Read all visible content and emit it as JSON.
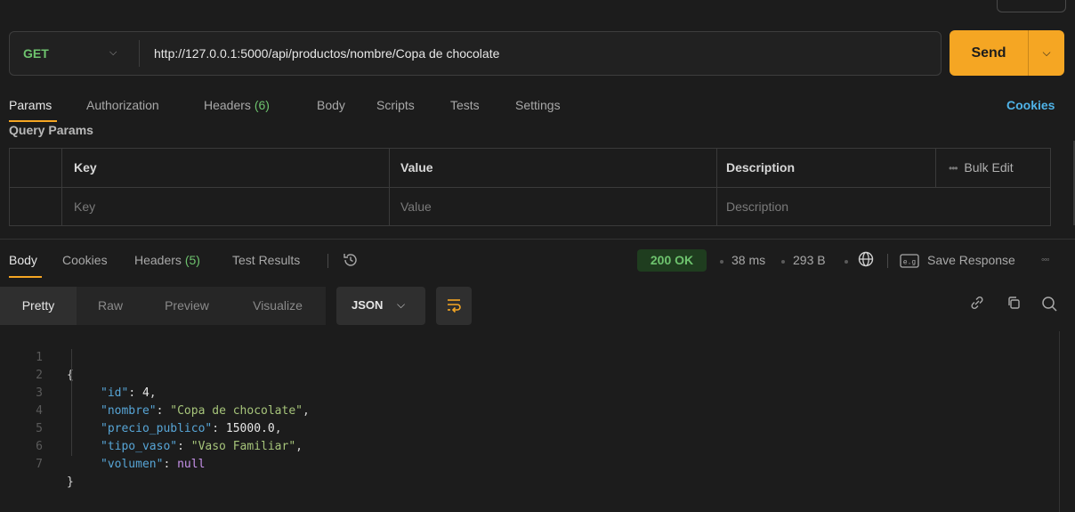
{
  "request": {
    "method": "GET",
    "url": "http://127.0.0.1:5000/api/productos/nombre/Copa de chocolate",
    "send_label": "Send"
  },
  "request_tabs": {
    "params": "Params",
    "authorization": "Authorization",
    "headers": "Headers",
    "headers_count": "(6)",
    "body": "Body",
    "scripts": "Scripts",
    "tests": "Tests",
    "settings": "Settings",
    "cookies": "Cookies"
  },
  "query_params": {
    "title": "Query Params",
    "headers": {
      "key": "Key",
      "value": "Value",
      "description": "Description",
      "bulk_edit": "Bulk Edit"
    },
    "placeholder_row": {
      "key": "Key",
      "value": "Value",
      "description": "Description"
    }
  },
  "response_tabs": {
    "body": "Body",
    "cookies": "Cookies",
    "headers": "Headers",
    "headers_count": "(5)",
    "test_results": "Test Results"
  },
  "response_meta": {
    "status": "200 OK",
    "time": "38 ms",
    "size": "293 B",
    "save_response": "Save Response"
  },
  "viewer": {
    "tabs": [
      "Pretty",
      "Raw",
      "Preview",
      "Visualize"
    ],
    "format": "JSON"
  },
  "code": {
    "line_numbers": [
      "1",
      "2",
      "3",
      "4",
      "5",
      "6",
      "7"
    ],
    "open_brace": "{",
    "close_brace": "}",
    "fields": [
      {
        "key": "\"id\"",
        "value": "4",
        "type": "number"
      },
      {
        "key": "\"nombre\"",
        "value": "\"Copa de chocolate\"",
        "type": "string"
      },
      {
        "key": "\"precio_publico\"",
        "value": "15000.0",
        "type": "number"
      },
      {
        "key": "\"tipo_vaso\"",
        "value": "\"Vaso Familiar\"",
        "type": "string"
      },
      {
        "key": "\"volumen\"",
        "value": "null",
        "type": "null"
      }
    ]
  },
  "colors": {
    "accent": "#f5a623",
    "method_get": "#6ec36e",
    "link": "#4fb3e8",
    "json_key": "#57a5d6",
    "json_string": "#a6c47a",
    "json_null": "#c792ea"
  }
}
